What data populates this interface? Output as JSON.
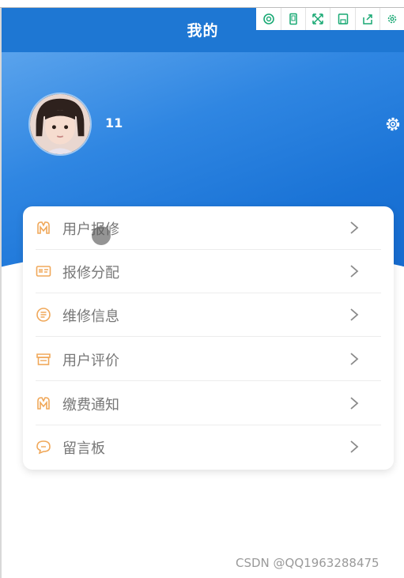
{
  "nav": {
    "title": "我的"
  },
  "toolbar": {
    "icons": [
      "magnify-icon",
      "phone-icon",
      "expand-icon",
      "save-icon",
      "share-icon",
      "gear-icon"
    ]
  },
  "profile": {
    "username": "11"
  },
  "menu": {
    "items": [
      {
        "label": "用户报修",
        "icon": "wrench-icon"
      },
      {
        "label": "报修分配",
        "icon": "card-icon"
      },
      {
        "label": "维修信息",
        "icon": "info-icon"
      },
      {
        "label": "用户评价",
        "icon": "store-icon"
      },
      {
        "label": "缴费通知",
        "icon": "wrench-icon"
      },
      {
        "label": "留言板",
        "icon": "chat-icon"
      }
    ]
  },
  "watermark": "CSDN @QQ1963288475",
  "colors": {
    "primary": "#1e77d3",
    "accent_icon": "#f0a85a",
    "toolbar_icon": "#19a974"
  }
}
